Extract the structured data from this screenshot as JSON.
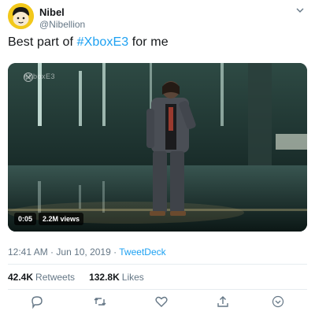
{
  "user": {
    "display_name": "Nibel",
    "handle": "@Nibellion",
    "avatar_icon": "cartoon-face-avatar"
  },
  "tweet": {
    "text_before": "Best part of ",
    "hashtag": "#XboxE3",
    "text_after": " for me"
  },
  "media": {
    "watermark": "#XboxE3",
    "duration": "0:05",
    "views": "2.2M views"
  },
  "meta": {
    "time": "12:41 AM",
    "date": "Jun 10, 2019",
    "separator": "·",
    "source": "TweetDeck"
  },
  "stats": {
    "retweets_count": "42.4K",
    "retweets_label": "Retweets",
    "likes_count": "132.8K",
    "likes_label": "Likes"
  },
  "colors": {
    "accent": "#1da1f2",
    "muted": "#657786",
    "text": "#14171a",
    "avatar_bg": "#f2c81b"
  },
  "actions": [
    "reply-icon",
    "retweet-icon",
    "like-icon",
    "share-icon",
    "analytics-icon"
  ]
}
